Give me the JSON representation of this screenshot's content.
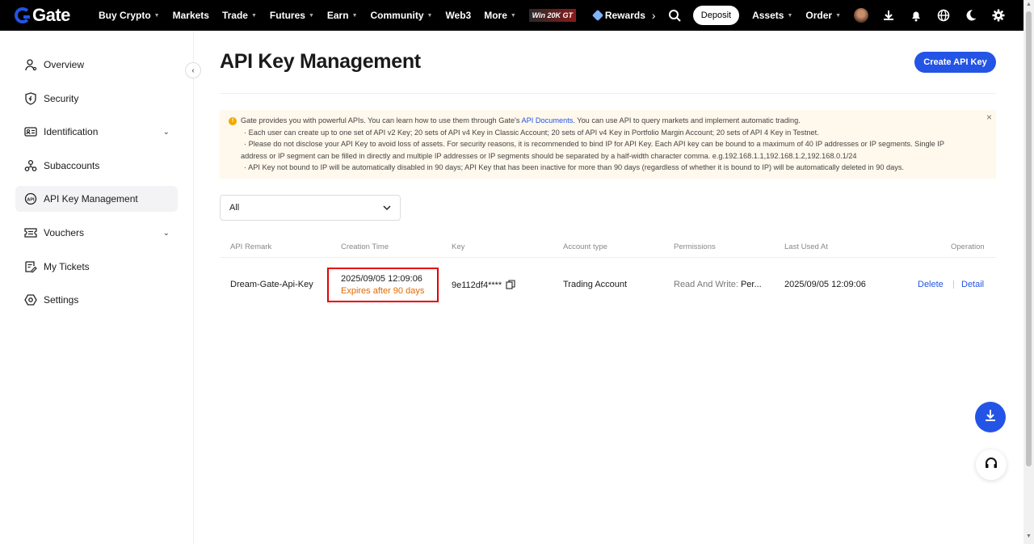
{
  "nav": {
    "logo_text": "Gate",
    "items": [
      {
        "label": "Buy Crypto",
        "caret": true
      },
      {
        "label": "Markets",
        "caret": false
      },
      {
        "label": "Trade",
        "caret": true
      },
      {
        "label": "Futures",
        "caret": true
      },
      {
        "label": "Earn",
        "caret": true
      },
      {
        "label": "Community",
        "caret": true
      },
      {
        "label": "Web3",
        "caret": false
      },
      {
        "label": "More",
        "caret": true
      }
    ],
    "promo_text": "Win 20K GT",
    "rewards_label": "Rewards",
    "deposit_label": "Deposit",
    "assets_label": "Assets",
    "order_label": "Order"
  },
  "sidebar": {
    "items": [
      {
        "label": "Overview",
        "icon": "user-icon"
      },
      {
        "label": "Security",
        "icon": "shield-icon"
      },
      {
        "label": "Identification",
        "icon": "id-card-icon",
        "expandable": true
      },
      {
        "label": "Subaccounts",
        "icon": "users-icon"
      },
      {
        "label": "API Key Management",
        "icon": "api-icon",
        "active": true
      },
      {
        "label": "Vouchers",
        "icon": "voucher-icon",
        "expandable": true
      },
      {
        "label": "My Tickets",
        "icon": "ticket-icon"
      },
      {
        "label": "Settings",
        "icon": "gear-icon"
      }
    ]
  },
  "main": {
    "title": "API Key Management",
    "create_button": "Create API Key",
    "notice": {
      "intro_before": "Gate provides you with powerful APIs. You can learn how to use them through Gate's ",
      "intro_link": "API Documents",
      "intro_after": ". You can use API to query markets and implement automatic trading.",
      "bullet1": "· Each user can create up to one set of API v2 Key; 20 sets of API v4 Key in Classic Account; 20 sets of API v4 Key in Portfolio Margin Account; 20 sets of API 4 Key in Testnet.",
      "bullet2_line1": "· Please do not disclose your API Key to avoid loss of assets. For security reasons, it is recommended to bind IP for API Key. Each API key can be bound to a maximum of 40 IP addresses or IP segments. Single IP",
      "bullet2_line2": "address or IP segment can be filled in directly and multiple IP addresses or IP segments should be separated by a half-width character comma. e.g.192.168.1.1,192.168.1.2,192.168.0.1/24",
      "bullet3": "· API Key not bound to IP will be automatically disabled in 90 days; API Key that has been inactive for more than 90 days (regardless of whether it is bound to IP) will be automatically deleted in 90 days."
    },
    "filter_value": "All",
    "table": {
      "headers": {
        "remark": "API Remark",
        "creation": "Creation Time",
        "key": "Key",
        "account": "Account type",
        "permissions": "Permissions",
        "last_used": "Last Used At",
        "operation": "Operation"
      },
      "row": {
        "remark": "Dream-Gate-Api-Key",
        "creation_time": "2025/09/05 12:09:06",
        "expires": "Expires after 90 days",
        "key": "9e112df4****",
        "account_type": "Trading Account",
        "permissions_label": "Read And Write:",
        "permissions_value": " Per...",
        "last_used": "2025/09/05 12:09:06",
        "delete": "Delete",
        "detail": "Detail"
      }
    }
  },
  "colors": {
    "accent": "#2354e6",
    "warning": "#e06a00",
    "highlight": "#e60000"
  }
}
